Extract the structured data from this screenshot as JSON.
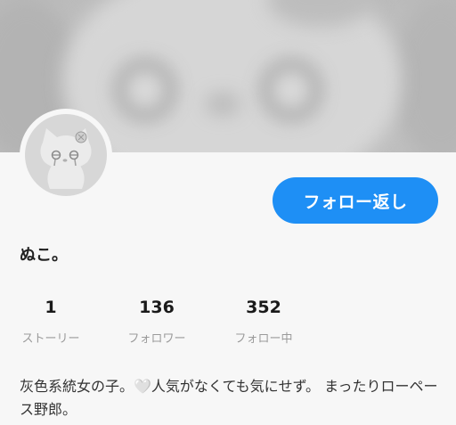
{
  "profile": {
    "display_name": "ぬこ。",
    "follow_button_label": "フォロー返し",
    "bio": "灰色系統女の子。🤍人気がなくても気にせず。 まったりローペース野郎。"
  },
  "stats": [
    {
      "value": "1",
      "label": "ストーリー"
    },
    {
      "value": "136",
      "label": "フォロワー"
    },
    {
      "value": "352",
      "label": "フォロー中"
    }
  ],
  "colors": {
    "accent": "#1e8ff5",
    "background": "#f7f7f7",
    "muted_text": "#9b9b9b"
  },
  "icons": {
    "avatar": "cartoon-cat-avatar"
  }
}
